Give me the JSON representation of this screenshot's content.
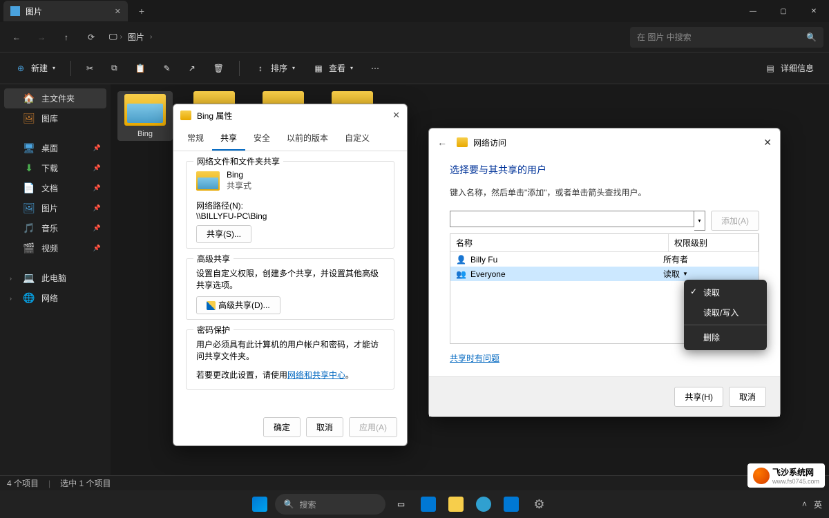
{
  "window": {
    "tab_title": "图片",
    "min": "—",
    "max": "▢",
    "close": "✕"
  },
  "nav": {
    "back": "←",
    "fwd": "→",
    "up": "↑",
    "refresh": "⟳",
    "monitor": "🖵",
    "bc1": "图片",
    "search_ph": "在 图片 中搜索"
  },
  "toolbar": {
    "new": "新建",
    "sort": "排序",
    "view": "查看",
    "details": "详细信息",
    "cut": "✂",
    "copy": "⧉",
    "paste": "📋",
    "rename": "✎",
    "share": "↗",
    "delete": "🗑",
    "more": "⋯"
  },
  "sidebar": {
    "items": [
      {
        "icon": "🏠",
        "label": "主文件夹",
        "sel": true,
        "pin": false
      },
      {
        "icon": "🖼",
        "label": "图库",
        "pin": false
      },
      {
        "gap": true
      },
      {
        "icon": "🖥",
        "label": "桌面",
        "pin": true,
        "color": "#4aa3df"
      },
      {
        "icon": "⬇",
        "label": "下载",
        "pin": true,
        "color": "#4caf50"
      },
      {
        "icon": "📄",
        "label": "文档",
        "pin": true,
        "color": "#4aa3df"
      },
      {
        "icon": "🖼",
        "label": "图片",
        "pin": true,
        "color": "#4aa3df"
      },
      {
        "icon": "🎵",
        "label": "音乐",
        "pin": true,
        "color": "#ff9800"
      },
      {
        "icon": "🎬",
        "label": "视频",
        "pin": true,
        "color": "#9c27b0"
      },
      {
        "gap": true
      },
      {
        "icon": "💻",
        "label": "此电脑",
        "chev": true
      },
      {
        "icon": "🌐",
        "label": "网络",
        "chev": true
      }
    ]
  },
  "files": {
    "f1": "Bing"
  },
  "status": {
    "count": "4 个项目",
    "sel": "选中 1 个项目"
  },
  "props": {
    "title": "Bing 属性",
    "tabs": [
      "常规",
      "共享",
      "安全",
      "以前的版本",
      "自定义"
    ],
    "active_tab": 1,
    "g1_title": "网络文件和文件夹共享",
    "folder_name": "Bing",
    "share_state": "共享式",
    "netpath_lbl": "网络路径(N):",
    "netpath": "\\\\BILLYFU-PC\\Bing",
    "share_btn": "共享(S)...",
    "g2_title": "高级共享",
    "g2_desc": "设置自定义权限，创建多个共享，并设置其他高级共享选项。",
    "adv_btn": "高级共享(D)...",
    "g3_title": "密码保护",
    "g3_l1": "用户必须具有此计算机的用户帐户和密码，才能访问共享文件夹。",
    "g3_l2": "若要更改此设置，请使用",
    "g3_link": "网络和共享中心",
    "g3_l2b": "。",
    "ok": "确定",
    "cancel": "取消",
    "apply": "应用(A)"
  },
  "share": {
    "title": "网络访问",
    "h": "选择要与其共享的用户",
    "sub": "键入名称，然后单击\"添加\"，或者单击箭头查找用户。",
    "add": "添加(A)",
    "col_name": "名称",
    "col_perm": "权限级别",
    "rows": [
      {
        "icon": "👤",
        "name": "Billy Fu",
        "perm": "所有者"
      },
      {
        "icon": "👥",
        "name": "Everyone",
        "perm": "读取",
        "dd": true,
        "sel": true
      }
    ],
    "help": "共享时有问题",
    "share_btn": "共享(H)",
    "cancel": "取消"
  },
  "menu": {
    "m1": "读取",
    "m2": "读取/写入",
    "m3": "删除"
  },
  "taskbar": {
    "search_lbl": "搜索",
    "ime": "英"
  },
  "wm": {
    "t": "飞沙系统网",
    "s": "www.fs0745.com"
  }
}
